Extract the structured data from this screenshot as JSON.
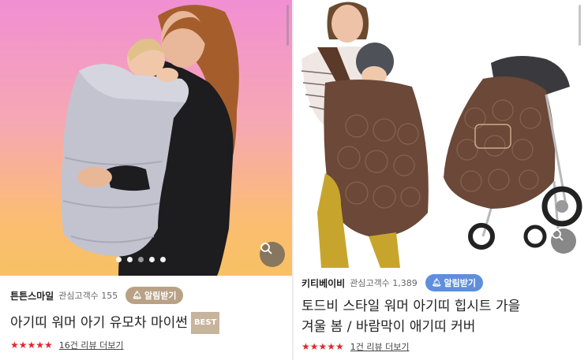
{
  "products": [
    {
      "seller": "튼튼스마일",
      "fans_label": "관심고객수 155",
      "alarm_label": "알림받기",
      "title": "아기띠 워머 아기 유모차 마이썬",
      "badge": "BEST",
      "stars": "★★★★★",
      "reviews": "16건 리뷰 더보기",
      "carousel_pages": 5,
      "carousel_active": 1,
      "colors": {
        "accent": "#b9a185",
        "badge": "#c7b49d"
      }
    },
    {
      "seller": "키티베이비",
      "fans_label": "관심고객수 1,389",
      "alarm_label": "알림받기",
      "title_line1": "토드비 스타일 워머 아기띠 힙시트 가을",
      "title_line2": "겨울 봄 / 바람막이 애기띠 커버",
      "stars": "★★★★★",
      "reviews": "1건 리뷰 더보기",
      "colors": {
        "accent": "#5f8fdc"
      }
    }
  ],
  "colors": {
    "star": "#e0282e"
  },
  "icons": {
    "zoom": "magnifier-icon",
    "alarm": "bell-icon"
  }
}
